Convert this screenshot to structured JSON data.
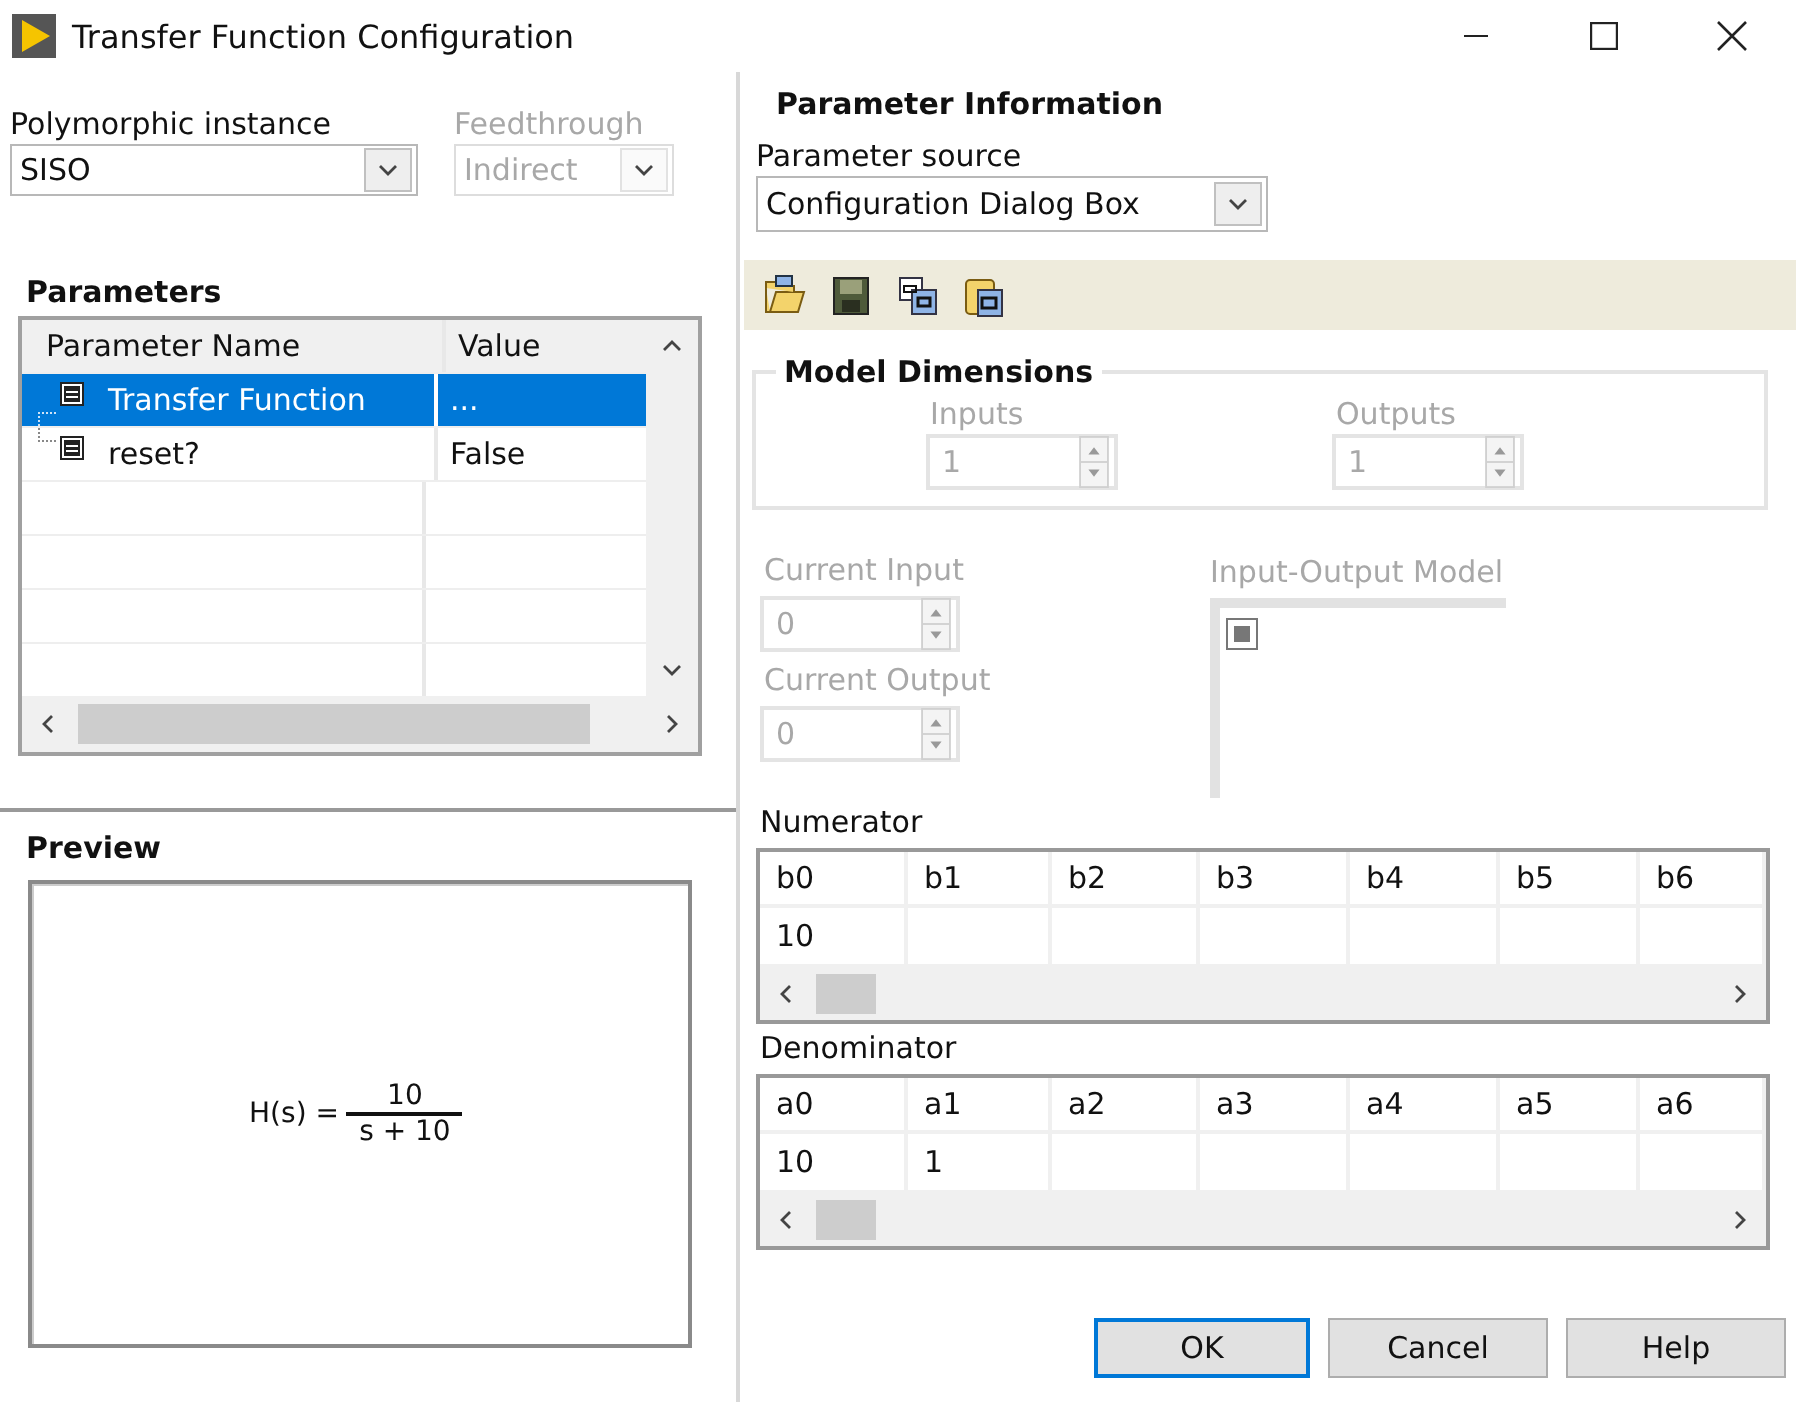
{
  "window": {
    "title": "Transfer Function Configuration"
  },
  "polymorphic_instance": {
    "label": "Polymorphic instance",
    "value": "SISO",
    "disabled": false
  },
  "feedthrough": {
    "label": "Feedthrough",
    "value": "Indirect",
    "disabled": true
  },
  "parameters": {
    "title": "Parameters",
    "columns": [
      "Parameter Name",
      "Value"
    ],
    "rows": [
      {
        "name": "Transfer Function",
        "value": "...",
        "selected": true
      },
      {
        "name": "reset?",
        "value": "False",
        "selected": false
      }
    ]
  },
  "preview": {
    "title": "Preview",
    "formula": {
      "lhs": "H(s) =",
      "numerator": "10",
      "denominator": "s + 10"
    }
  },
  "parameter_information": {
    "title": "Parameter Information",
    "source": {
      "label": "Parameter source",
      "value": "Configuration Dialog Box"
    }
  },
  "model_dimensions": {
    "title": "Model Dimensions",
    "inputs": {
      "label": "Inputs",
      "value": "1",
      "disabled": true
    },
    "outputs": {
      "label": "Outputs",
      "value": "1",
      "disabled": true
    }
  },
  "current_input": {
    "label": "Current Input",
    "value": "0",
    "disabled": true
  },
  "current_output": {
    "label": "Current Output",
    "value": "0",
    "disabled": true
  },
  "io_model": {
    "label": "Input-Output Model",
    "disabled": true
  },
  "numerator": {
    "label": "Numerator",
    "columns": [
      "b0",
      "b1",
      "b2",
      "b3",
      "b4",
      "b5",
      "b6"
    ],
    "values": [
      "10"
    ]
  },
  "denominator": {
    "label": "Denominator",
    "columns": [
      "a0",
      "a1",
      "a2",
      "a3",
      "a4",
      "a5",
      "a6"
    ],
    "values": [
      "10",
      "1"
    ]
  },
  "buttons": [
    {
      "label": "OK",
      "default": true
    },
    {
      "label": "Cancel",
      "default": false
    },
    {
      "label": "Help",
      "default": false
    }
  ]
}
